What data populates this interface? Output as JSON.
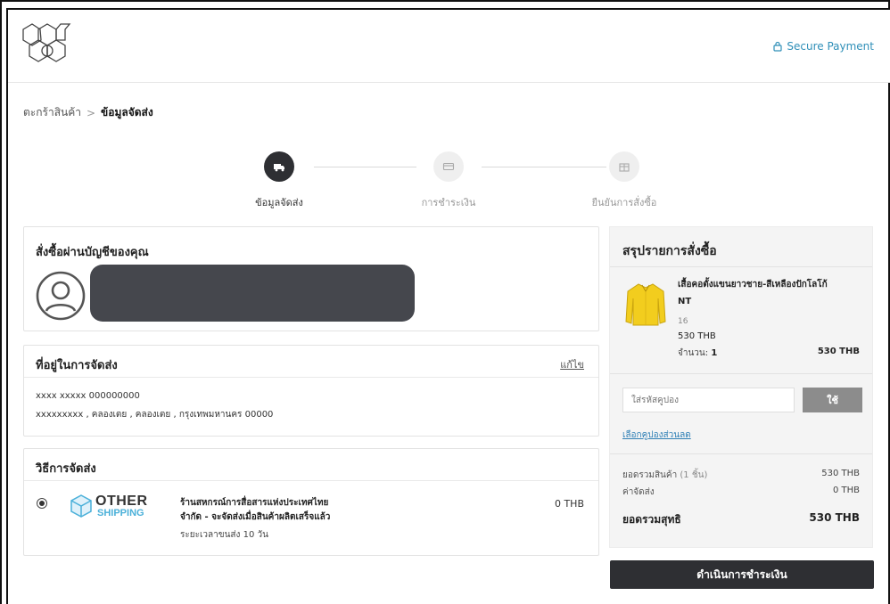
{
  "header": {
    "secure_label": "Secure Payment"
  },
  "breadcrumb": {
    "cart": "ตะกร้าสินค้า",
    "separator": ">",
    "current": "ข้อมูลจัดส่ง"
  },
  "stepper": {
    "steps": [
      {
        "label": "ข้อมูลจัดส่ง",
        "state": "active",
        "icon": "truck-icon"
      },
      {
        "label": "การชำระเงิน",
        "state": "inactive",
        "icon": "card-icon"
      },
      {
        "label": "ยืนยันการสั่งซื้อ",
        "state": "inactive",
        "icon": "box-icon"
      }
    ]
  },
  "account": {
    "title": "สั่งซื้อผ่านบัญชีของคุณ"
  },
  "address": {
    "title": "ที่อยู่ในการจัดส่ง",
    "edit_label": "แก้ไข",
    "line1": "xxxx xxxxx  000000000",
    "line2": "xxxxxxxxx , คลองเตย , คลองเตย , กรุงเทพมหานคร 00000"
  },
  "shipping": {
    "title": "วิธีการจัดส่ง",
    "logo_top": "OTHER",
    "logo_bottom": "SHIPPING",
    "name_line1": "ร้านสหกรณ์การสื่อสารแห่งประเทศไทย",
    "name_line2": "จำกัด - จะจัดส่งเมื่อสินค้าผลิตเสร็จแล้ว",
    "time": "ระยะเวลาขนส่ง 10 วัน",
    "price": "0 THB"
  },
  "summary": {
    "title": "สรุปรายการสั่งซื้อ",
    "product": {
      "name_line1": "เสื้อคอตั้งแขนยาวชาย-สีเหลืองปักโลโก้",
      "name_line2": "NT",
      "size": "16",
      "price": "530 THB",
      "qty_label": "จำนวน:",
      "qty_value": "1",
      "total": "530 THB"
    },
    "coupon_placeholder": "ใส่รหัสคูปอง",
    "coupon_button": "ใช้",
    "coupon_link": "เลือกคูปองส่วนลด",
    "subtotal_label": "ยอดรวมสินค้า",
    "subtotal_count": "(1 ชิ้น)",
    "subtotal_value": "530 THB",
    "shipping_label": "ค่าจัดส่ง",
    "shipping_value": "0 THB",
    "net_label": "ยอดรวมสุทธิ",
    "net_value": "530 THB"
  },
  "checkout_label": "ดำเนินการชำระเงิน",
  "colors": {
    "primary_dark": "#2e2f33",
    "link_blue": "#2e7fb5",
    "secure_blue": "#2f8fb8",
    "shipping_accent": "#4ab0d9"
  }
}
